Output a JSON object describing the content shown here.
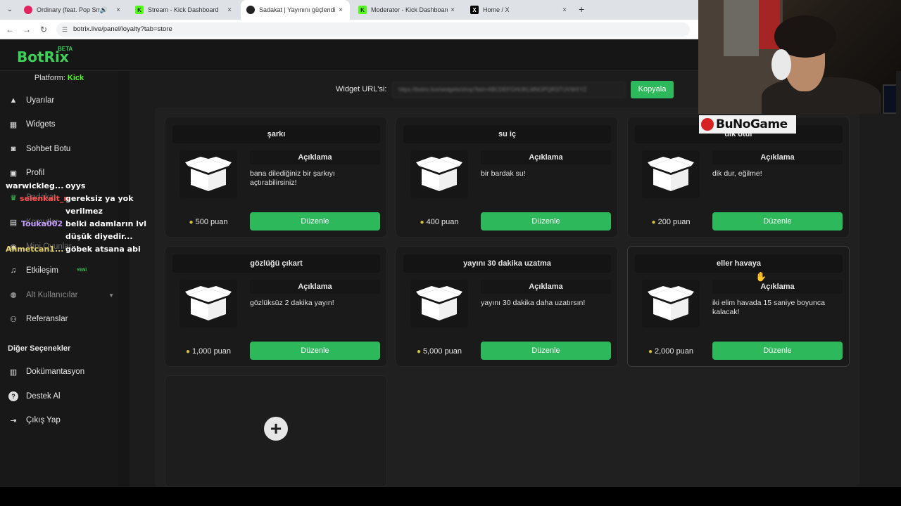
{
  "browser": {
    "tabs": [
      {
        "title": "Ordinary (feat. Pop Smoke)",
        "favicon_color": "#e0245e",
        "favicon_glyph": "",
        "active": false
      },
      {
        "title": "Stream - Kick Dashboard",
        "favicon_color": "#53fc18",
        "favicon_glyph": "K",
        "active": false
      },
      {
        "title": "Sadakat | Yayınını güçlendirmek",
        "favicon_color": "#222222",
        "favicon_glyph": "",
        "active": true
      },
      {
        "title": "Moderator - Kick Dashboard",
        "favicon_color": "#53fc18",
        "favicon_glyph": "K",
        "active": false
      },
      {
        "title": "Home / X",
        "favicon_color": "#000000",
        "favicon_glyph": "X",
        "active": false
      }
    ],
    "url": "botrix.live/panel/loyalty?tab=store",
    "new_tab_symbol": "+",
    "close_symbol": "×"
  },
  "app": {
    "logo": "BotRix",
    "logo_badge": "BETA",
    "accent": "#3ecf5a"
  },
  "sidebar": {
    "platform_label": "Platform:",
    "platform_value": "Kick",
    "items": [
      {
        "label": "Uyarılar",
        "icon": "warning-icon"
      },
      {
        "label": "Widgets",
        "icon": "grid-icon"
      },
      {
        "label": "Sohbet Botu",
        "icon": "robot-icon"
      },
      {
        "label": "Profil",
        "icon": "id-card-icon"
      },
      {
        "label": "Sadakat",
        "icon": "trophy-icon"
      },
      {
        "label": "Komutlar",
        "icon": "terminal-icon"
      },
      {
        "label": "Mini Oyunlar",
        "icon": "gamepad-icon"
      },
      {
        "label": "Etkileşim",
        "icon": "music-icon",
        "badge": "YENİ"
      },
      {
        "label": "Alt Kullanıcılar",
        "icon": "users-icon"
      },
      {
        "label": "Referanslar",
        "icon": "handshake-icon"
      }
    ],
    "section_title": "Diğer Seçenekler",
    "other_items": [
      {
        "label": "Dokümantasyon",
        "icon": "book-icon"
      },
      {
        "label": "Destek Al",
        "icon": "help-icon"
      },
      {
        "label": "Çıkış Yap",
        "icon": "logout-icon"
      }
    ]
  },
  "chat": [
    {
      "user": "warwickleg...",
      "user_color": "#ffffff",
      "message": "oyys"
    },
    {
      "user": "selenkalt_n",
      "user_color": "#ff4d4d",
      "message": "gereksiz ya yok"
    },
    {
      "user": "",
      "user_color": "#ffffff",
      "message": "verilmez"
    },
    {
      "user": "Touka002",
      "user_color": "#c59cff",
      "message": "belki adamların lvl"
    },
    {
      "user": "",
      "user_color": "#ffffff",
      "message": "düşük diyedir..."
    },
    {
      "user": "Ahmetcan1...",
      "user_color": "#e6d36a",
      "message": "göbek atsana abi"
    }
  ],
  "store": {
    "widget_url_label": "Widget URL'si:",
    "widget_url_value": "https://botrix.live/widgets/shop?bid=ABCDEFGHIJKLMNOPQRSTUVWXYZ",
    "copy_label": "Kopyala",
    "desc_header": "Açıklama",
    "edit_label": "Düzenle",
    "items": [
      {
        "title": "şarkı",
        "description": "bana dilediğiniz bir şarkıyı açtırabilirsiniz!",
        "price": "500 puan"
      },
      {
        "title": "su iç",
        "description": "bir bardak su!",
        "price": "400 puan"
      },
      {
        "title": "dik otur",
        "description": "dik dur, eğilme!",
        "price": "200 puan"
      },
      {
        "title": "gözlüğü çıkart",
        "description": "gözlüksüz 2 dakika yayın!",
        "price": "1,000 puan"
      },
      {
        "title": "yayını 30 dakika uzatma",
        "description": "yayını 30 dakika daha uzatırsın!",
        "price": "5,000 puan"
      },
      {
        "title": "eller havaya",
        "description": "iki elim havada 15 saniye boyunca kalacak!",
        "price": "2,000 puan"
      }
    ],
    "add_symbol": "+"
  },
  "overlay": {
    "brand": "BuNoGame"
  }
}
